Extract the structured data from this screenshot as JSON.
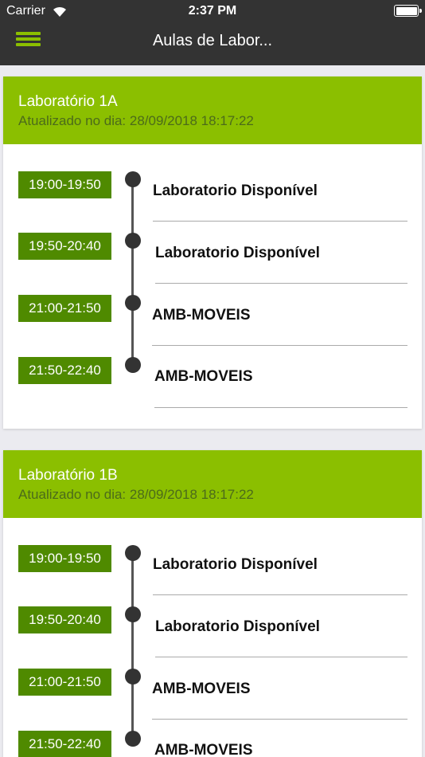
{
  "status_bar": {
    "carrier": "Carrier",
    "time": "2:37 PM"
  },
  "nav": {
    "title": "Aulas de Labor..."
  },
  "labs": [
    {
      "name": "Laboratório 1A",
      "updated": "Atualizado no dia: 28/09/2018 18:17:22",
      "slots": [
        {
          "time": "19:00-19:50",
          "label": "Laboratorio Disponível"
        },
        {
          "time": "19:50-20:40",
          "label": "Laboratorio Disponível"
        },
        {
          "time": "21:00-21:50",
          "label": "AMB-MOVEIS"
        },
        {
          "time": "21:50-22:40",
          "label": "AMB-MOVEIS"
        }
      ]
    },
    {
      "name": "Laboratório 1B",
      "updated": "Atualizado no dia: 28/09/2018 18:17:22",
      "slots": [
        {
          "time": "19:00-19:50",
          "label": "Laboratorio Disponível"
        },
        {
          "time": "19:50-20:40",
          "label": "Laboratorio Disponível"
        },
        {
          "time": "21:00-21:50",
          "label": "AMB-MOVEIS"
        },
        {
          "time": "21:50-22:40",
          "label": "AMB-MOVEIS"
        }
      ]
    }
  ]
}
